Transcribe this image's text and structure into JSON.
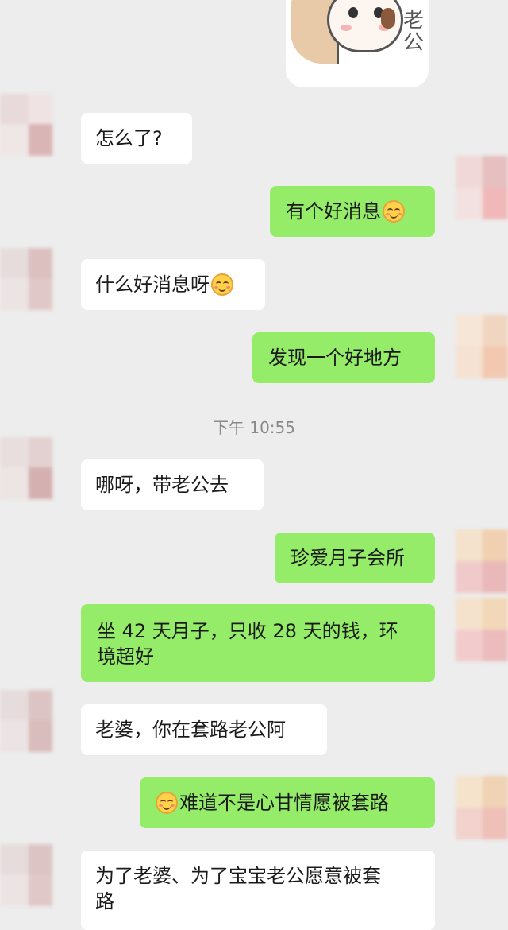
{
  "sticker": {
    "text": "老公",
    "icon": "cartoon-girl-sticker"
  },
  "timestamp": "下午 10:55",
  "colors": {
    "background": "#ededed",
    "incoming_bubble": "#ffffff",
    "outgoing_bubble": "#95ec69",
    "timestamp_text": "#8a8a8a"
  },
  "messages": [
    {
      "side": "in",
      "text": "怎么了?",
      "emoji": null
    },
    {
      "side": "out",
      "text": "有个好消息",
      "emoji": "smiling-emoji-after"
    },
    {
      "side": "in",
      "text": "什么好消息呀",
      "emoji": "smiling-emoji-after"
    },
    {
      "side": "out",
      "text": "发现一个好地方",
      "emoji": null
    },
    {
      "side": "in",
      "text": "哪呀，带老公去",
      "emoji": null
    },
    {
      "side": "out",
      "text": "珍爱月子会所",
      "emoji": null
    },
    {
      "side": "out",
      "text": "坐 42 天月子，只收 28 天的钱，环\n境超好",
      "emoji": null
    },
    {
      "side": "in",
      "text": "老婆，你在套路老公阿",
      "emoji": null
    },
    {
      "side": "out",
      "text": "难道不是心甘情愿被套路",
      "emoji": "smiling-emoji-before"
    },
    {
      "side": "in",
      "text": "为了老婆、为了宝宝老公愿意被套\n路",
      "emoji": null
    }
  ]
}
